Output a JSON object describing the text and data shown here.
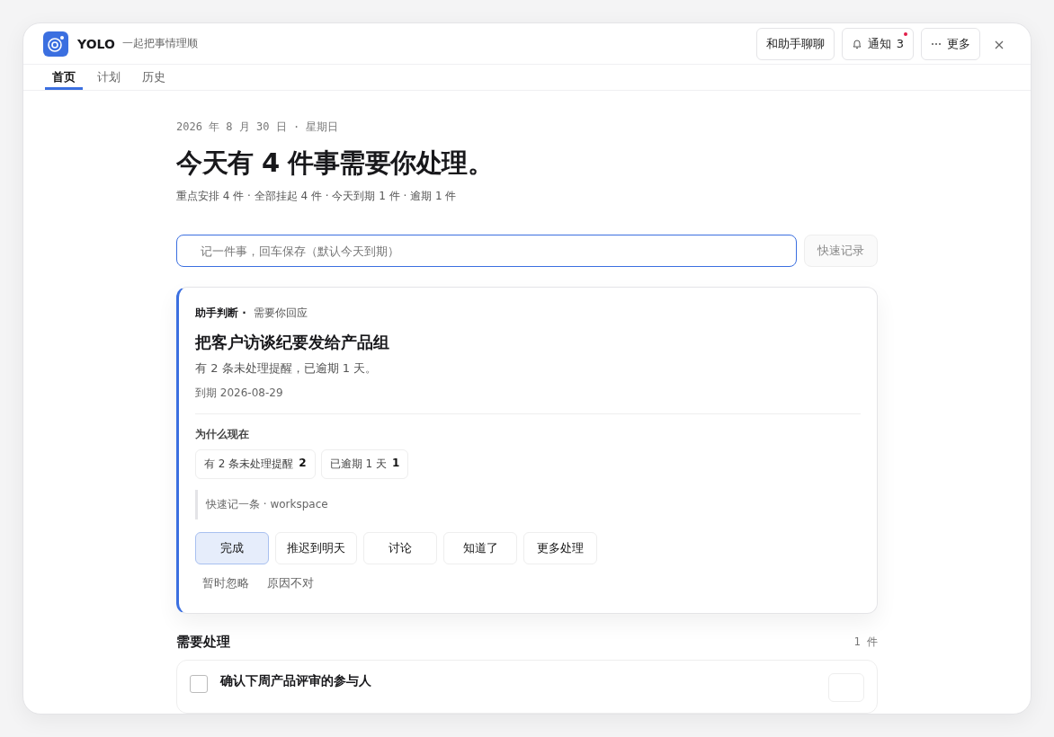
{
  "app": {
    "name": "YOLO",
    "tagline": "一起把事情理顺"
  },
  "header_actions": [
    {
      "kind": "text",
      "label": "和助手聊聊"
    },
    {
      "kind": "bell",
      "label": "通知",
      "count": "3",
      "unread": true
    },
    {
      "kind": "more",
      "label": "更多"
    }
  ],
  "tabs": [
    {
      "label": "首页",
      "selected": true
    },
    {
      "label": "计划",
      "selected": false
    },
    {
      "label": "历史",
      "selected": false
    }
  ],
  "date_line": "2026 年 8 月 30 日 · 星期日",
  "headline": "今天有 4 件事需要你处理。",
  "summary": "重点安排 4 件 · 全部挂起 4 件 · 今天到期 1 件 · 逾期 1 件",
  "quick_add": {
    "placeholder": "记一件事，回车保存（默认今天到期）",
    "button": "快速记录"
  },
  "focus_card": {
    "source": "助手判断 ·",
    "status": "需要你回应",
    "title": "把客户访谈纪要发给产品组",
    "detail": "有 2 条未处理提醒，已逾期 1 天。",
    "due": "到期 2026-08-29",
    "why_title": "为什么现在",
    "reasons": [
      {
        "label": "有 2 条未处理提醒",
        "count": "2"
      },
      {
        "label": "已逾期 1 天",
        "count": "1"
      }
    ],
    "note": "快速记一条 · workspace",
    "actions": [
      {
        "label": "完成",
        "primary": true
      },
      {
        "label": "推迟到明天",
        "primary": false
      },
      {
        "label": "讨论",
        "primary": false
      },
      {
        "label": "知道了",
        "primary": false
      },
      {
        "label": "更多处理",
        "primary": false
      }
    ],
    "links": [
      "暂时忽略",
      "原因不对"
    ]
  },
  "section": {
    "title": "需要处理",
    "count": "1 件",
    "items": [
      {
        "title": "确认下周产品评审的参与人",
        "checked": false
      }
    ]
  }
}
